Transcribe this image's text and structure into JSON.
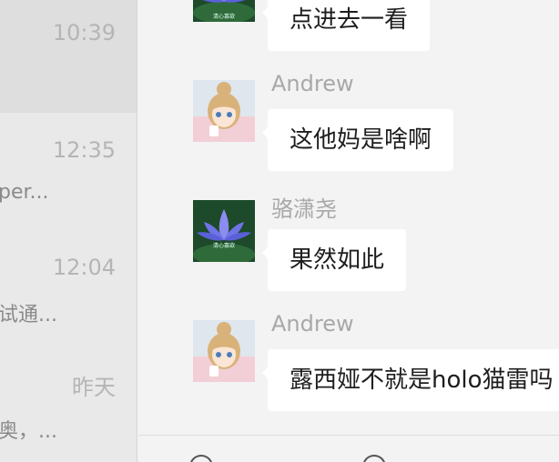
{
  "sidebar": {
    "conversations": [
      {
        "time": "10:39",
        "preview": ""
      },
      {
        "time": "12:35",
        "preview": "per..."
      },
      {
        "time": "12:04",
        "preview": "试通..."
      },
      {
        "time": "昨天",
        "preview": "奥，..."
      }
    ]
  },
  "chat": {
    "messages": [
      {
        "sender": "",
        "text": "点进去一看",
        "avatar": "lotus-avatar"
      },
      {
        "sender": "Andrew",
        "text": "这他妈是啥啊",
        "avatar": "anime-girl-avatar"
      },
      {
        "sender": "骆潇尧",
        "text": "果然如此",
        "avatar": "lotus-avatar"
      },
      {
        "sender": "Andrew",
        "text": "露西娅不就是holo猫雷吗",
        "avatar": "anime-girl-avatar"
      }
    ],
    "lotus_caption": "清心寡欲"
  },
  "colors": {
    "sidebar_bg": "#e9e9e9",
    "chat_bg": "#f3f3f3",
    "bubble_bg": "#ffffff",
    "muted_text": "#a8a8a8"
  }
}
